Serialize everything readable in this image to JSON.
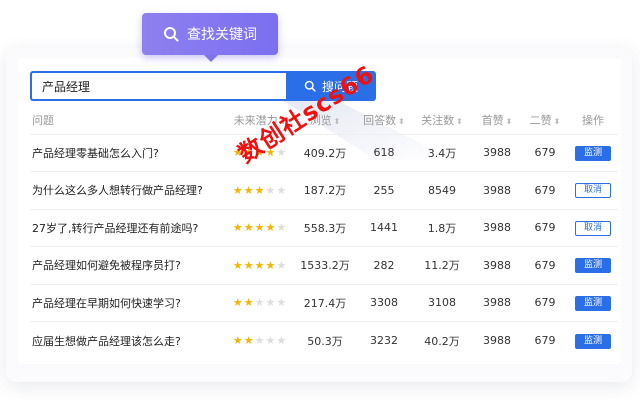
{
  "tooltip": {
    "label": "查找关键词",
    "icon": "search-icon"
  },
  "search": {
    "value": "产品经理",
    "button_label": "搜问题",
    "icon": "search-icon"
  },
  "table": {
    "columns": [
      {
        "label": "问题",
        "sortable": false
      },
      {
        "label": "未来潜力",
        "sortable": true
      },
      {
        "label": "浏览",
        "sortable": true
      },
      {
        "label": "回答数",
        "sortable": true
      },
      {
        "label": "关注数",
        "sortable": true
      },
      {
        "label": "首赞",
        "sortable": true
      },
      {
        "label": "二赞",
        "sortable": true
      },
      {
        "label": "操作",
        "sortable": false
      }
    ],
    "rows": [
      {
        "question": "产品经理零基础怎么入门?",
        "stars": 4,
        "views": "409.2万",
        "answers": "618",
        "followers": "3.4万",
        "likes1": "3988",
        "likes2": "679",
        "action": "监测",
        "action_type": "monitor"
      },
      {
        "question": "为什么这么多人想转行做产品经理?",
        "stars": 3,
        "views": "187.2万",
        "answers": "255",
        "followers": "8549",
        "likes1": "3988",
        "likes2": "679",
        "action": "取消",
        "action_type": "cancel"
      },
      {
        "question": "27岁了,转行产品经理还有前途吗?",
        "stars": 4,
        "views": "558.3万",
        "answers": "1441",
        "followers": "1.8万",
        "likes1": "3988",
        "likes2": "679",
        "action": "取消",
        "action_type": "cancel"
      },
      {
        "question": "产品经理如何避免被程序员打?",
        "stars": 4,
        "views": "1533.2万",
        "answers": "282",
        "followers": "11.2万",
        "likes1": "3988",
        "likes2": "679",
        "action": "监测",
        "action_type": "monitor"
      },
      {
        "question": "产品经理在早期如何快速学习?",
        "stars": 2,
        "views": "217.4万",
        "answers": "3308",
        "followers": "3108",
        "likes1": "3988",
        "likes2": "679",
        "action": "监测",
        "action_type": "monitor"
      },
      {
        "question": "应届生想做产品经理该怎么走?",
        "stars": 2,
        "views": "50.3万",
        "answers": "3232",
        "followers": "40.2万",
        "likes1": "3988",
        "likes2": "679",
        "action": "监测",
        "action_type": "monitor"
      }
    ],
    "max_stars": 5
  },
  "watermark": "数创社scs66",
  "colors": {
    "accent": "#2b6fe8",
    "tooltip": "#8478ef",
    "star": "#f5b400",
    "watermark": "#ee1111"
  }
}
